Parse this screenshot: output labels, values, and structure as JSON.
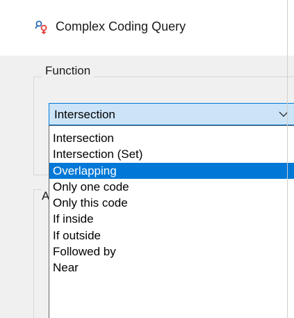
{
  "window": {
    "title": "Complex Coding Query",
    "icon": "coding-query-icon"
  },
  "function_group": {
    "legend": "Function",
    "combo": {
      "value": "Intersection",
      "expanded": true,
      "options": [
        "Intersection",
        "Intersection (Set)",
        "Overlapping",
        "Only one code",
        "Only this code",
        "If inside",
        "If outside",
        "Followed by",
        "Near"
      ],
      "highlighted_index": 2
    }
  },
  "second_group": {
    "legend_fragment": "A"
  },
  "colors": {
    "highlight": "#0078d7",
    "combo_bg": "#cce4f7",
    "icon_blue": "#2b6cb5",
    "icon_red": "#e0393e"
  }
}
